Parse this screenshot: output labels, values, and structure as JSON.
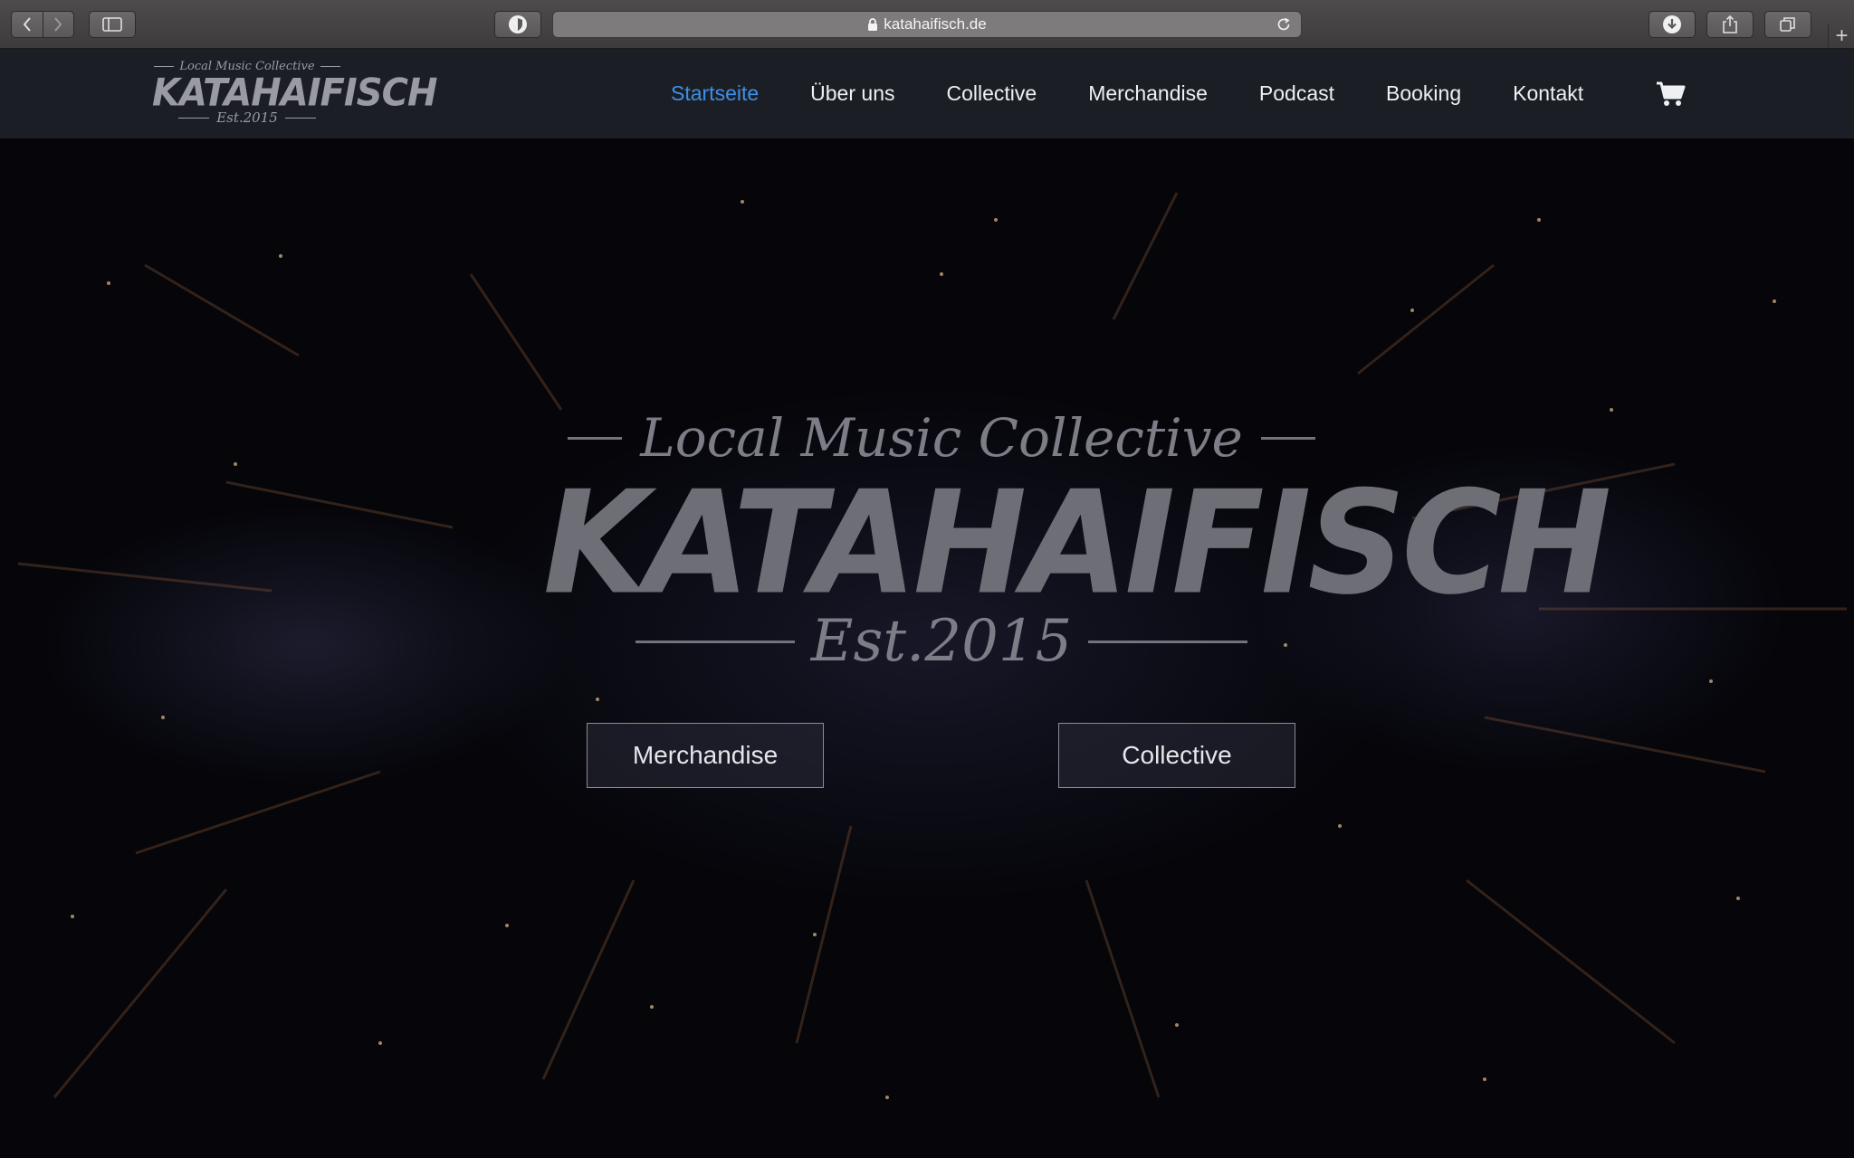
{
  "browser": {
    "url": "katahaifisch.de"
  },
  "site": {
    "logo": {
      "tagline": "Local Music Collective",
      "name": "KATAHAIFISCH",
      "est": "Est.2015"
    },
    "nav": [
      {
        "label": "Startseite",
        "active": true
      },
      {
        "label": "Über uns"
      },
      {
        "label": "Collective"
      },
      {
        "label": "Merchandise"
      },
      {
        "label": "Podcast"
      },
      {
        "label": "Booking"
      },
      {
        "label": "Kontakt"
      }
    ],
    "cart_icon": "shopping-cart-icon"
  },
  "hero": {
    "tagline": "Local Music Collective",
    "name": "KATAHAIFISCH",
    "est": "Est.2015",
    "buttons": [
      {
        "label": "Merchandise"
      },
      {
        "label": "Collective"
      }
    ]
  },
  "colors": {
    "nav_active": "#3f8fe6",
    "header_bg": "#1b1f25",
    "hero_bg": "#05050a"
  }
}
